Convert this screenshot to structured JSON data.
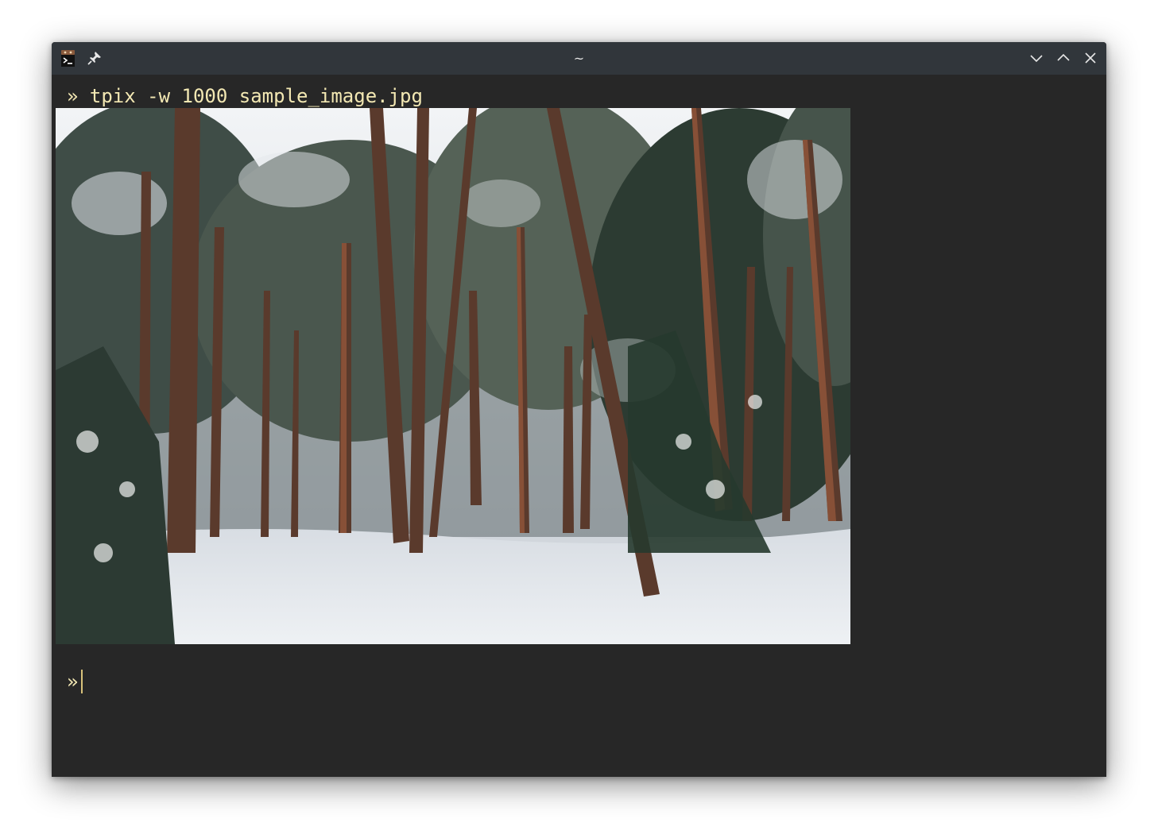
{
  "window": {
    "title": "~",
    "icons": {
      "app": "terminal-app-icon",
      "pin": "pin-icon",
      "minimize": "chevron-down-icon",
      "maximize": "chevron-up-icon",
      "close": "close-icon"
    }
  },
  "terminal": {
    "prompt_symbol": "»",
    "command": "tpix -w 1000 sample_image.jpg",
    "colors": {
      "background": "#272727",
      "prompt": "#f3e8b3",
      "cursor": "#d8c27a",
      "titlebar": "#31363b"
    }
  }
}
